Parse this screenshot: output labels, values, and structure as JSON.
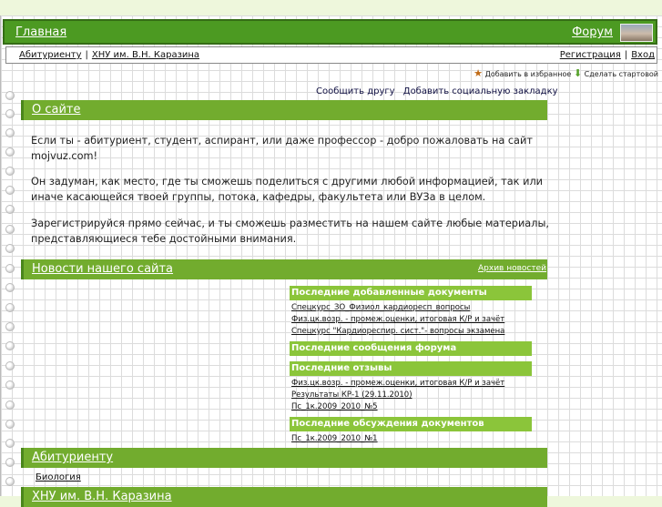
{
  "topbar": {
    "home": "Главная",
    "forum": "Форум",
    "logo_icon": "forum-logo"
  },
  "navbar": {
    "left": [
      "Абитуриенту",
      "ХНУ им. В.Н. Каразина"
    ],
    "right": [
      "Регистрация",
      "Вход"
    ]
  },
  "actions": {
    "favorites": "Добавить в избранное",
    "homepage": "Сделать стартовой"
  },
  "share": {
    "tell_friend": "Сообщить другу",
    "bookmark": "Добавить социальную закладку"
  },
  "about": {
    "title": "О сайте",
    "p1": "Если ты - абитуриент, студент, аспирант, или даже профессор - добро пожаловать на сайт mojvuz.com!",
    "p2": "Он задуман, как место, где ты сможешь поделиться с другими любой информацией, так или иначе касающейся твоей группы, потока, кафедры, факультета или ВУЗа в целом.",
    "p3": "Зарегистрируйся прямо сейчас, и ты сможешь разместить на нашем сайте любые материалы, представляющиеся тебе достойными внимания."
  },
  "news": {
    "title": "Новости нашего сайта",
    "archive": "Архив новостей"
  },
  "blocks": {
    "docs": {
      "title": "Последние добавленные документы",
      "links": [
        "Спецкурс_ЗО_Физиол_кардиоресп_вопросы",
        "Физ.цк.возр. - промеж.оценки, итоговая К/Р и зачёт",
        "Спецкурс \"Кардиореспир. сист.\"- вопросы экзамена"
      ]
    },
    "forum": {
      "title": "Последние сообщения форума"
    },
    "reviews": {
      "title": "Последние отзывы",
      "links": [
        "Физ.цк.возр. - промеж.оценки, итоговая К/Р и зачёт",
        "Результаты КР-1 (29.11.2010)",
        "Пс_1к.2009_2010_№5"
      ]
    },
    "discussions": {
      "title": "Последние обсуждения документов",
      "links": [
        "Пс_1к.2009_2010_№1"
      ]
    }
  },
  "applicants": {
    "title": "Абитуриенту",
    "sub": "Биология"
  },
  "university": {
    "title": "ХНУ им. В.Н. Каразина"
  },
  "colors": {
    "topbar": "#4c9a22",
    "section": "#72ac2e",
    "block": "#8bc53a"
  }
}
